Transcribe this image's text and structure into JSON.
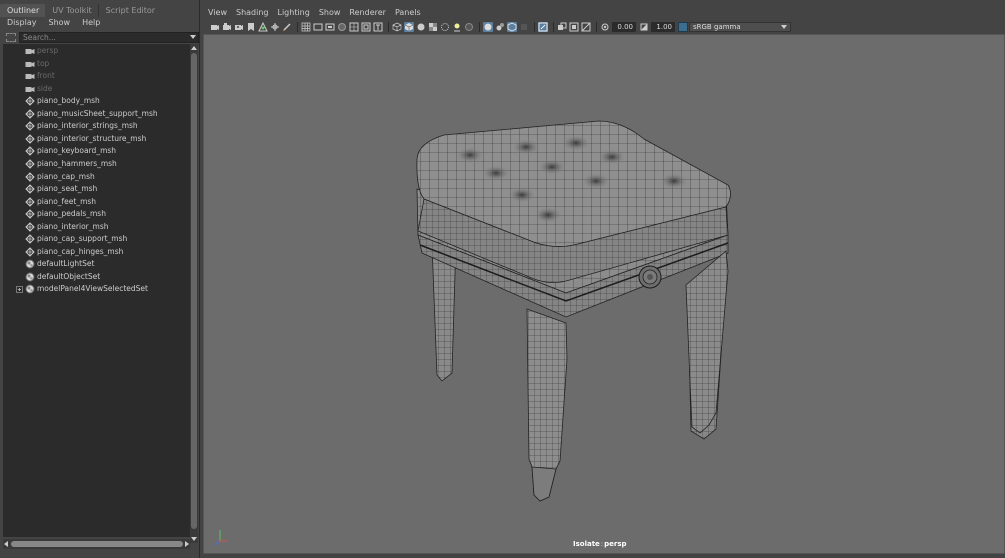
{
  "left_panel": {
    "tabs": [
      "Outliner",
      "UV Toolkit",
      "Script Editor"
    ],
    "menu": [
      "Display",
      "Show",
      "Help"
    ],
    "search_placeholder": "Search...",
    "items": [
      {
        "label": "persp",
        "kind": "camera",
        "dim": true
      },
      {
        "label": "top",
        "kind": "camera",
        "dim": true
      },
      {
        "label": "front",
        "kind": "camera",
        "dim": true
      },
      {
        "label": "side",
        "kind": "camera",
        "dim": true
      },
      {
        "label": "piano_body_msh",
        "kind": "mesh",
        "dim": false
      },
      {
        "label": "piano_musicSheet_support_msh",
        "kind": "mesh",
        "dim": false
      },
      {
        "label": "piano_interior_strings_msh",
        "kind": "mesh",
        "dim": false
      },
      {
        "label": "piano_interior_structure_msh",
        "kind": "mesh",
        "dim": false
      },
      {
        "label": "piano_keyboard_msh",
        "kind": "mesh",
        "dim": false
      },
      {
        "label": "piano_hammers_msh",
        "kind": "mesh",
        "dim": false
      },
      {
        "label": "piano_cap_msh",
        "kind": "mesh",
        "dim": false
      },
      {
        "label": "piano_seat_msh",
        "kind": "mesh",
        "dim": false
      },
      {
        "label": "piano_feet_msh",
        "kind": "mesh",
        "dim": false
      },
      {
        "label": "piano_pedals_msh",
        "kind": "mesh",
        "dim": false
      },
      {
        "label": "piano_interior_msh",
        "kind": "mesh",
        "dim": false
      },
      {
        "label": "piano_cap_support_msh",
        "kind": "mesh",
        "dim": false
      },
      {
        "label": "piano_cap_hinges_msh",
        "kind": "mesh",
        "dim": false
      },
      {
        "label": "defaultLightSet",
        "kind": "set",
        "dim": false
      },
      {
        "label": "defaultObjectSet",
        "kind": "set",
        "dim": false
      },
      {
        "label": "modelPanel4ViewSelectedSet",
        "kind": "set",
        "dim": false,
        "expandable": true
      }
    ]
  },
  "viewport": {
    "menu": [
      "View",
      "Shading",
      "Lighting",
      "Show",
      "Renderer",
      "Panels"
    ],
    "exposure": "0.00",
    "gamma": "1.00",
    "color_space": "sRGB gamma",
    "hud_isolate": "Isolate",
    "hud_separator": ":",
    "hud_camera": "persp",
    "background_color": "#6c6c6c",
    "mesh_color": "#8a8a8a",
    "wire_color": "#1f1f1f"
  }
}
